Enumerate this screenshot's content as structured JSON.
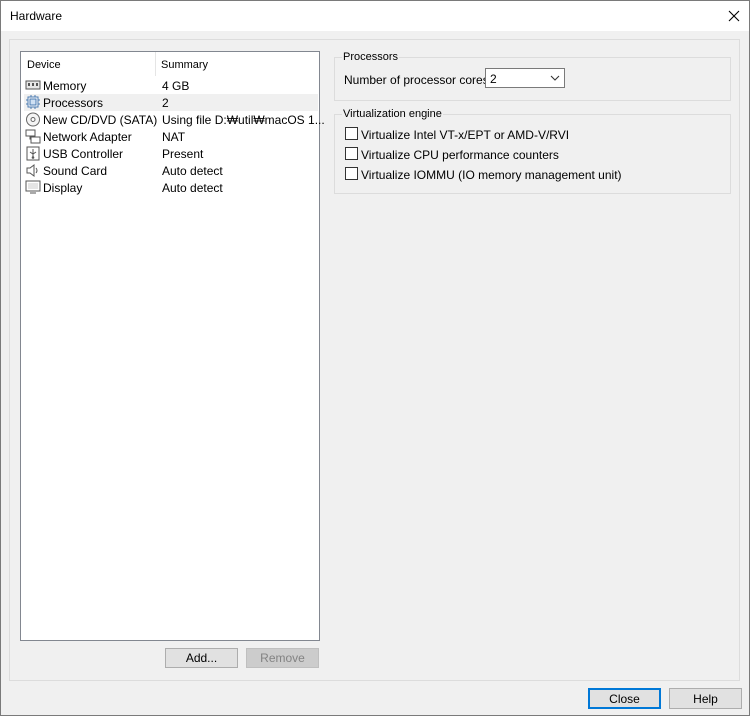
{
  "window": {
    "title": "Hardware"
  },
  "device_list": {
    "columns": [
      "Device",
      "Summary"
    ],
    "rows": [
      {
        "icon": "memory-icon",
        "name": "Memory",
        "summary": "4 GB"
      },
      {
        "icon": "processor-icon",
        "name": "Processors",
        "summary": "2"
      },
      {
        "icon": "cd-dvd-icon",
        "name": "New CD/DVD (SATA)",
        "summary": "Using file D:₩util₩macOS 1..."
      },
      {
        "icon": "network-adapter-icon",
        "name": "Network Adapter",
        "summary": "NAT"
      },
      {
        "icon": "usb-controller-icon",
        "name": "USB Controller",
        "summary": "Present"
      },
      {
        "icon": "sound-card-icon",
        "name": "Sound Card",
        "summary": "Auto detect"
      },
      {
        "icon": "display-icon",
        "name": "Display",
        "summary": "Auto detect"
      }
    ],
    "selected": "Processors"
  },
  "buttons": {
    "add": "Add...",
    "remove": "Remove",
    "close": "Close",
    "help": "Help"
  },
  "processors_group": {
    "title": "Processors",
    "cores_label": "Number of processor cores:",
    "cores_value": "2"
  },
  "virtualization_group": {
    "title": "Virtualization engine",
    "options": [
      {
        "label": "Virtualize Intel VT-x/EPT or AMD-V/RVI",
        "checked": false
      },
      {
        "label": "Virtualize CPU performance counters",
        "checked": false
      },
      {
        "label": "Virtualize IOMMU (IO memory management unit)",
        "checked": false
      }
    ]
  }
}
